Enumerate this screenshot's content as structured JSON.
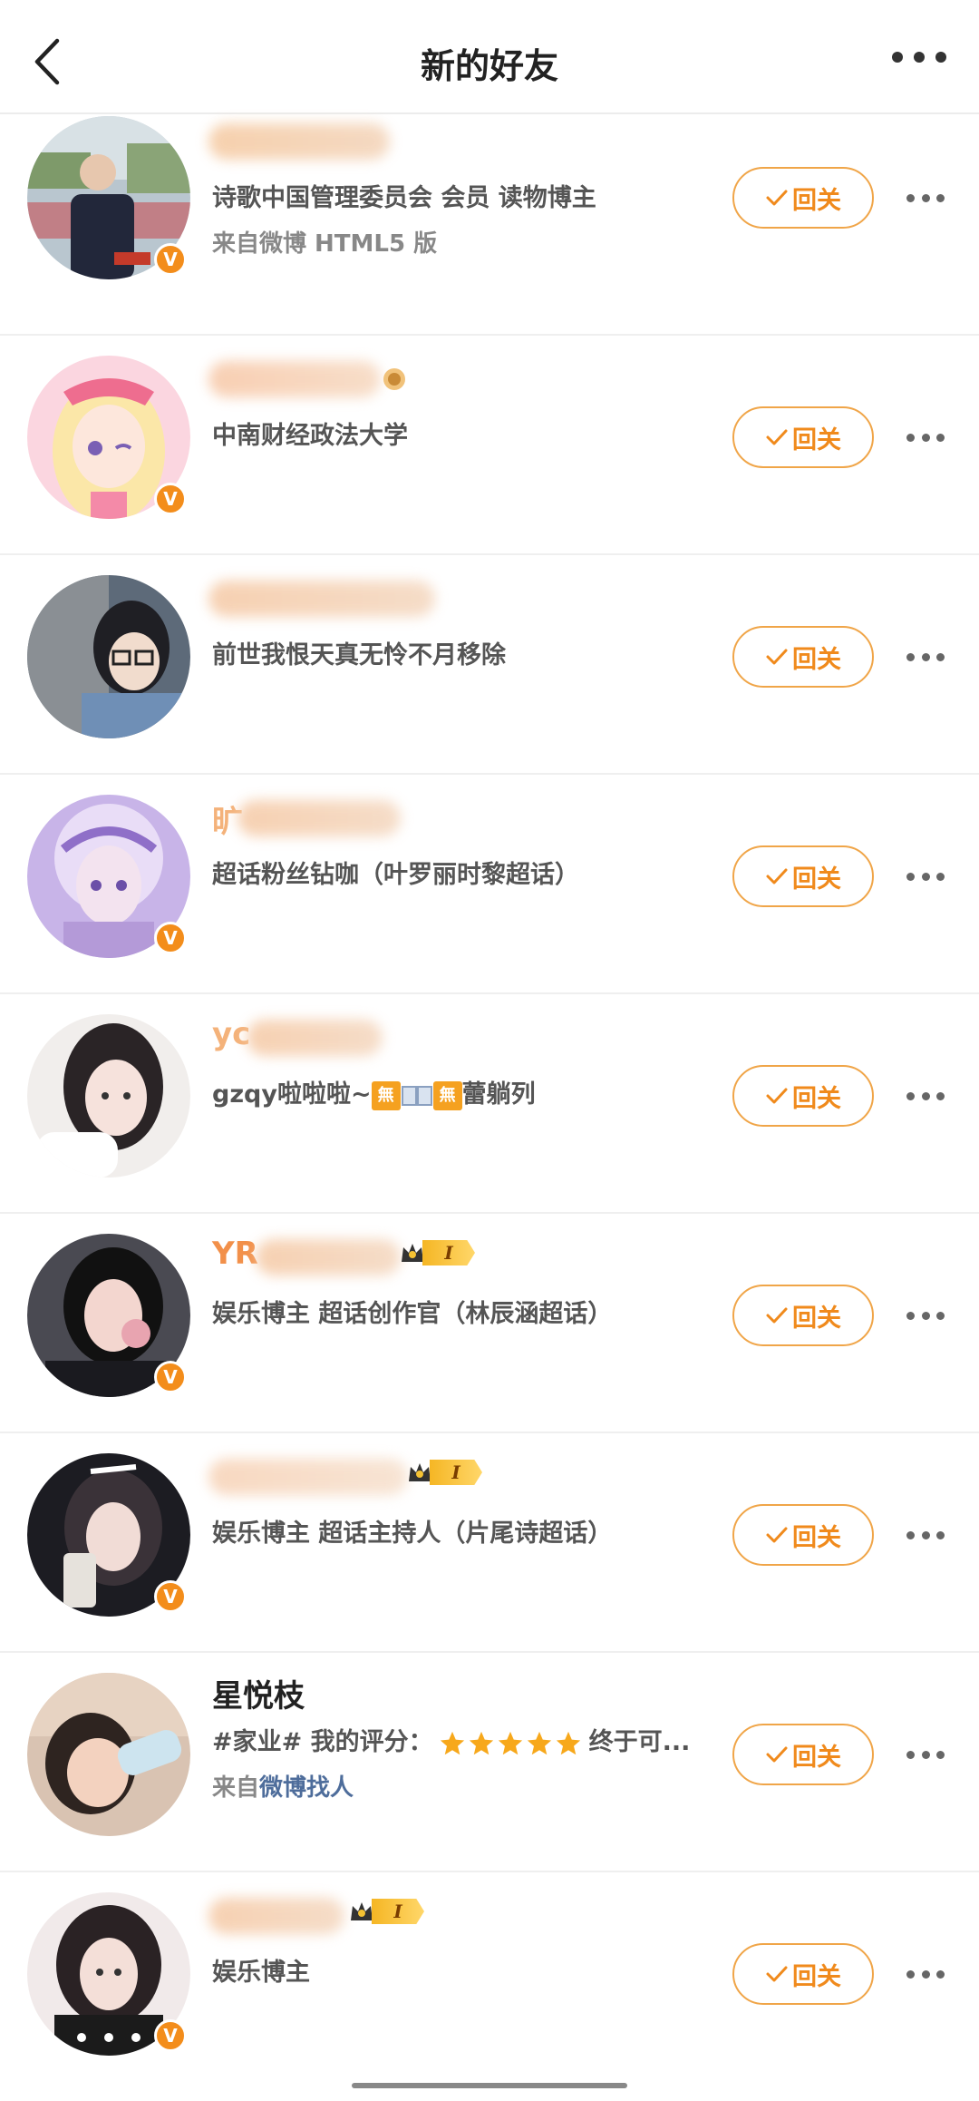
{
  "header": {
    "title": "新的好友",
    "back_icon": "chevron-left-icon",
    "more_icon": "more-horizontal-icon"
  },
  "follow_label": "回关",
  "colors": {
    "accent": "#f08a1c",
    "verified_badge": "#f38d1b",
    "link": "#4e6d9b"
  },
  "users": [
    {
      "name": "",
      "name_visible": false,
      "verified": true,
      "desc": "诗歌中国管理委员会  会员  读物博主",
      "source_prefix": "来自微博 HTML5 版",
      "source_link": ""
    },
    {
      "name": "",
      "name_visible": false,
      "verified": true,
      "desc": "中南财经政法大学",
      "source_prefix": "",
      "source_link": ""
    },
    {
      "name": "",
      "name_visible": false,
      "verified": false,
      "desc": "前世我恨天真无怜不月移除",
      "source_prefix": "",
      "source_link": ""
    },
    {
      "name": "旷",
      "name_visible": false,
      "verified": true,
      "desc": "超话粉丝钻咖（叶罗丽时黎超话）",
      "source_prefix": "",
      "source_link": ""
    },
    {
      "name": "yc",
      "name_visible": false,
      "verified": false,
      "desc_prefix": "gzqy啦啦啦~",
      "desc_chip": "無",
      "desc_suffix": "蕾躺列",
      "source_prefix": "",
      "source_link": ""
    },
    {
      "name": "YR",
      "name_visible": false,
      "verified": true,
      "medal_level": "I",
      "desc": "娱乐博主  超话创作官（林辰涵超话）",
      "source_prefix": "",
      "source_link": ""
    },
    {
      "name": "",
      "name_visible": false,
      "verified": true,
      "medal_level": "I",
      "desc": "娱乐博主  超话主持人（片尾诗超话）",
      "source_prefix": "",
      "source_link": ""
    },
    {
      "name": "星悦枝",
      "name_visible": true,
      "verified": false,
      "desc_prefix": "#家业#  我的评分：",
      "rating": 5,
      "desc_suffix": "终于可...",
      "source_prefix": "来自",
      "source_link": "微博找人"
    },
    {
      "name": "",
      "name_visible": false,
      "verified": true,
      "medal_level": "I",
      "desc": "娱乐博主",
      "source_prefix": "",
      "source_link": ""
    }
  ]
}
